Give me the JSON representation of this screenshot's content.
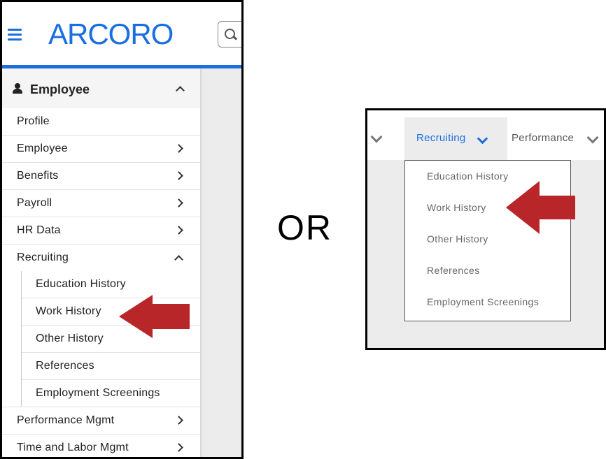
{
  "left": {
    "logo": "ARCORO",
    "menu_title": "Employee",
    "items": [
      {
        "label": "Profile",
        "chevron": "none"
      },
      {
        "label": "Employee",
        "chevron": "right"
      },
      {
        "label": "Benefits",
        "chevron": "right"
      },
      {
        "label": "Payroll",
        "chevron": "right"
      },
      {
        "label": "HR Data",
        "chevron": "right"
      },
      {
        "label": "Recruiting",
        "chevron": "up"
      }
    ],
    "recruiting_sub": [
      "Education History",
      "Work History",
      "Other History",
      "References",
      "Employment Screenings"
    ],
    "items_after": [
      {
        "label": "Performance Mgmt",
        "chevron": "right"
      },
      {
        "label": "Time and Labor Mgmt",
        "chevron": "right"
      }
    ]
  },
  "separator": "OR",
  "right": {
    "active_tab": "Recruiting",
    "next_tab": "Performance",
    "dropdown": [
      "Education History",
      "Work History",
      "Other History",
      "References",
      "Employment Screenings"
    ]
  },
  "colors": {
    "brand_blue": "#1a6fe0",
    "arrow_red": "#b8262a",
    "content_gray": "#ececec"
  }
}
